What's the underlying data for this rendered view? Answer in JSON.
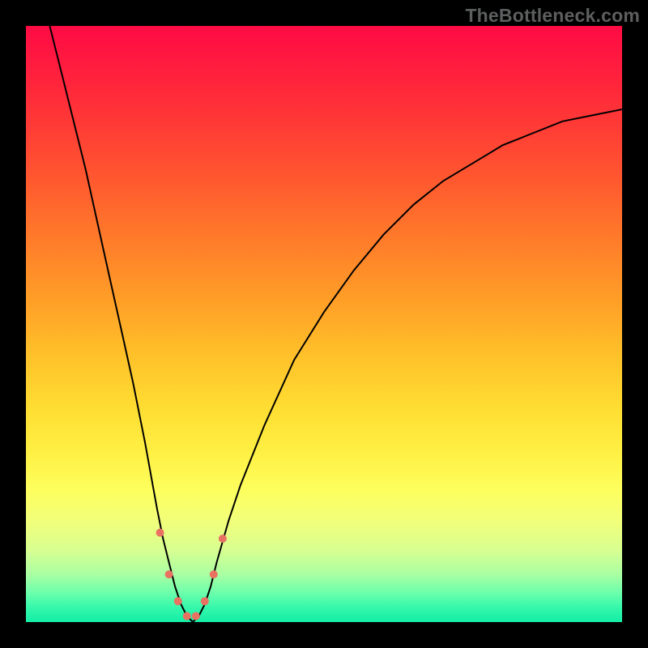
{
  "watermark": "TheBottleneck.com",
  "colors": {
    "frame": "#000000",
    "curve": "#000000",
    "markers": "#e97162",
    "gradient_top": "#ff0b44",
    "gradient_bottom": "#13eda6"
  },
  "chart_data": {
    "type": "line",
    "title": "",
    "xlabel": "",
    "ylabel": "",
    "xlim": [
      0,
      100
    ],
    "ylim": [
      0,
      100
    ],
    "grid": false,
    "legend": false,
    "series": [
      {
        "name": "bottleneck-curve",
        "x": [
          4,
          6,
          8,
          10,
          12,
          14,
          16,
          18,
          20,
          22,
          23,
          24,
          25,
          26,
          27,
          28,
          29,
          30,
          31,
          32,
          34,
          36,
          40,
          45,
          50,
          55,
          60,
          65,
          70,
          75,
          80,
          85,
          90,
          95,
          100
        ],
        "y": [
          100,
          92,
          84,
          76,
          67,
          58,
          49,
          40,
          30,
          19,
          14,
          10,
          6,
          3,
          1,
          0,
          1,
          3,
          6,
          10,
          17,
          23,
          33,
          44,
          52,
          59,
          65,
          70,
          74,
          77,
          80,
          82,
          84,
          85,
          86
        ]
      }
    ],
    "markers": {
      "series": "bottleneck-curve",
      "points_x": [
        22.5,
        24.0,
        25.5,
        27.0,
        28.5,
        30.0,
        31.5,
        33.0
      ],
      "points_y": [
        15.0,
        8.0,
        3.5,
        1.0,
        1.0,
        3.5,
        8.0,
        14.0
      ],
      "style": "dots",
      "size": 10,
      "color": "#e97162"
    },
    "background": {
      "type": "vertical-gradient",
      "stops": [
        {
          "pos": 0.0,
          "color": "#ff0b44"
        },
        {
          "pos": 0.5,
          "color": "#ffb728"
        },
        {
          "pos": 0.78,
          "color": "#f9ff62"
        },
        {
          "pos": 1.0,
          "color": "#13eda6"
        }
      ],
      "meaning": "top = high bottleneck (red), bottom = low bottleneck (green)"
    }
  }
}
